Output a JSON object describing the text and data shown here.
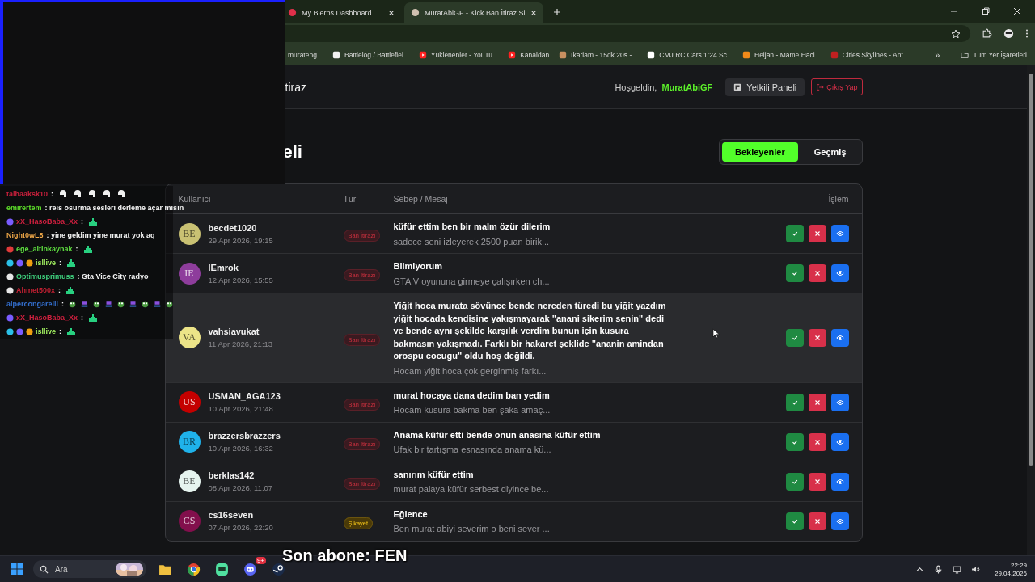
{
  "browser": {
    "tabs": [
      {
        "title": "My Blerps Dashboard",
        "selected": false
      },
      {
        "title": "MuratAbiGF - Kick Ban İtiraz Si",
        "selected": true
      }
    ],
    "bookmarks": [
      {
        "label": "murateng...",
        "kind": "none"
      },
      {
        "label": "Battlelog / Battlefiel...",
        "kind": "page"
      },
      {
        "label": "Yüklenenler - YouTu...",
        "kind": "youtube"
      },
      {
        "label": "Kanaldan",
        "kind": "youtube"
      },
      {
        "label": "Ikariam - 15dk 20s -..."
      },
      {
        "label": "CMJ RC Cars 1:24 Sc...",
        "kind": "amazon"
      },
      {
        "label": "Heijan - Mame Haci...",
        "kind": "orange"
      },
      {
        "label": "Cities Skylines - Ant...",
        "kind": "game"
      }
    ],
    "more": "»",
    "all_bookmarks": "Tüm Yer İşaretleri"
  },
  "navbar": {
    "title": "tiraz",
    "greeting": "Hoşgeldin,",
    "user": "MuratAbiGF",
    "panel_button": "Yetkili Paneli",
    "logout_button": "Çıkış Yap"
  },
  "heading": "eli",
  "filters": [
    {
      "label": "Bekleyenler",
      "selected": true
    },
    {
      "label": "Geçmiş",
      "selected": false
    }
  ],
  "table": {
    "columns": [
      "Kullanıcı",
      "Tür",
      "Sebep / Mesaj",
      "İşlem"
    ],
    "rows": [
      {
        "initials": "BE",
        "color": "#c9c173",
        "user": "becdet1020",
        "date": "29 Apr 2026, 19:15",
        "type": "Ban İtirazı",
        "kind": "ban",
        "title": "küfür ettim ben bir malm özür dilerim",
        "preview": "sadece seni izleyerek 2500 puan birik...",
        "hovered": false
      },
      {
        "initials": "IE",
        "color": "#8e3d9c",
        "user": "lEmrok",
        "date": "12 Apr 2026, 15:55",
        "type": "Ban İtirazı",
        "kind": "ban",
        "title": "Bilmiyorum",
        "preview": "GTA V oyununa girmeye çalışırken ch...",
        "hovered": false
      },
      {
        "initials": "VA",
        "color": "#ece488",
        "user": "vahsiavukat",
        "date": "11 Apr 2026, 21:13",
        "type": "Ban İtirazı",
        "kind": "ban",
        "title": "Yiğit hoca murata sövünce bende nereden türedi bu yiğit yazdım yiğit hocada kendisine yakışmayarak \"anani sikerim senin\" dedi ve bende aynı şekilde karşılık verdim bunun için kusura bakmasın yakışmadı. Farklı bir hakaret şeklide \"ananin amindan orospu cocugu\" oldu hoş değildi.",
        "preview": "Hocam yiğit hoca çok gerginmiş farkı...",
        "hovered": true
      },
      {
        "initials": "US",
        "color": "#c40000",
        "user": "USMAN_AGA123",
        "date": "10 Apr 2026, 21:48",
        "type": "Ban İtirazı",
        "kind": "ban",
        "title": "murat hocaya dana dedim ban yedim",
        "preview": "Hocam kusura bakma ben şaka amaç...",
        "hovered": false
      },
      {
        "initials": "BR",
        "color": "#1fb2ea",
        "user": "brazzersbrazzers",
        "date": "10 Apr 2026, 16:32",
        "type": "Ban İtirazı",
        "kind": "ban",
        "title": "Anama küfür etti bende onun anasına küfür ettim",
        "preview": "Ufak bir tartışma esnasında anama kü...",
        "hovered": false
      },
      {
        "initials": "BE",
        "color": "#e6f4ef",
        "user": "berklas142",
        "date": "08 Apr 2026, 11:07",
        "type": "Ban İtirazı",
        "kind": "ban",
        "title": "sanırım küfür ettim",
        "preview": "murat palaya küfür serbest diyince be...",
        "hovered": false
      },
      {
        "initials": "CS",
        "color": "#820f4c",
        "user": "cs16seven",
        "date": "07 Apr 2026, 22:20",
        "type": "Şikayet",
        "kind": "complaint",
        "title": "Eğlence",
        "preview": "Ben murat abiyi severim o beni sever ...",
        "hovered": false
      }
    ]
  },
  "chat": [
    {
      "user": "talhaaksk10",
      "color": "#c8203c",
      "message": ":",
      "emotes": [
        {
          "kind": "helmet"
        },
        {
          "kind": "helmet"
        },
        {
          "kind": "helmet"
        },
        {
          "kind": "helmet"
        },
        {
          "kind": "helmet"
        }
      ]
    },
    {
      "user": "emirertem",
      "color": "#5ee02a",
      "message": ": reis osurma sesleri derleme açar mısın"
    },
    {
      "user": "xX_HasoBaba_Xx",
      "color": "#d0203f",
      "badges": [
        {
          "color": "#7a5cff"
        }
      ],
      "message": ":",
      "emotes": [
        {
          "kind": "tower"
        }
      ]
    },
    {
      "user": "Night0wL8",
      "color": "#f0a848",
      "message": ": yine geldim yine murat yok aq"
    },
    {
      "user": "ege_altinkaynak",
      "color": "#5fe040",
      "badges": [
        {
          "color": "#e03a3a"
        }
      ],
      "message": ":",
      "emotes": [
        {
          "kind": "tower"
        }
      ]
    },
    {
      "user": "isllive",
      "color": "#a2f060",
      "badges": [
        {
          "color": "#2bc0e8"
        },
        {
          "color": "#7a5cff"
        },
        {
          "color": "#f0a010"
        }
      ],
      "message": ":",
      "emotes": [
        {
          "kind": "tower"
        }
      ]
    },
    {
      "user": "Optimusprimuss",
      "color": "#3fd27e",
      "badges": [
        {
          "color": "#e8e8e8"
        }
      ],
      "message": ": Gta Vice City radyo"
    },
    {
      "user": "Ahmet500x",
      "color": "#c22032",
      "badges": [
        {
          "color": "#e8e8e8"
        }
      ],
      "message": ":",
      "emotes": [
        {
          "kind": "tower"
        }
      ]
    },
    {
      "user": "alpercongarelli",
      "color": "#3470d0",
      "message": ":",
      "emotes": [
        {
          "kind": "frog"
        },
        {
          "kind": "pc"
        },
        {
          "kind": "frog"
        },
        {
          "kind": "pc"
        },
        {
          "kind": "frog"
        },
        {
          "kind": "pc"
        },
        {
          "kind": "frog"
        },
        {
          "kind": "pc"
        },
        {
          "kind": "frog"
        }
      ]
    },
    {
      "user": "xX_HasoBaba_Xx",
      "color": "#d0203f",
      "badges": [
        {
          "color": "#7a5cff"
        }
      ],
      "message": ":",
      "emotes": [
        {
          "kind": "tower"
        }
      ]
    },
    {
      "user": "isllive",
      "color": "#a2f060",
      "badges": [
        {
          "color": "#2bc0e8"
        },
        {
          "color": "#7a5cff"
        },
        {
          "color": "#f0a010"
        }
      ],
      "message": ":",
      "emotes": [
        {
          "kind": "tower"
        }
      ]
    }
  ],
  "overlay_text": "Son abone: FEN",
  "taskbar": {
    "search_placeholder": "Ara",
    "discord_badge": "9+",
    "time": "22:29",
    "date": "29.04.2026"
  }
}
